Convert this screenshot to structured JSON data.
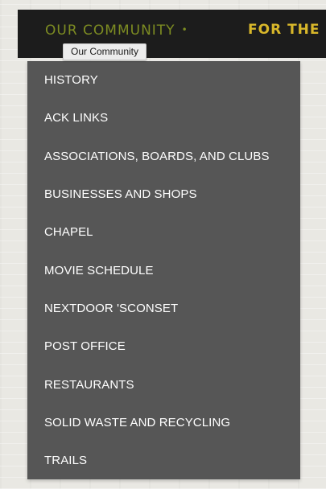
{
  "nav": {
    "active_label": "OUR COMMUNITY",
    "active_indicator": "•",
    "next_label": "FOR THE L",
    "colors": {
      "bar_background": "#1c1c1c",
      "active": "#7d8c22",
      "next": "#d8b72a"
    }
  },
  "tooltip": {
    "text": "Our Community"
  },
  "dropdown": {
    "background": "#565656",
    "items": [
      {
        "label": "HISTORY"
      },
      {
        "label": "ACK LINKS"
      },
      {
        "label": "ASSOCIATIONS, BOARDS, AND CLUBS"
      },
      {
        "label": "BUSINESSES AND SHOPS"
      },
      {
        "label": "CHAPEL"
      },
      {
        "label": "MOVIE SCHEDULE"
      },
      {
        "label": "NEXTDOOR 'SCONSET"
      },
      {
        "label": "POST OFFICE"
      },
      {
        "label": "RESTAURANTS"
      },
      {
        "label": "SOLID WASTE AND RECYCLING"
      },
      {
        "label": "TRAILS"
      }
    ]
  }
}
